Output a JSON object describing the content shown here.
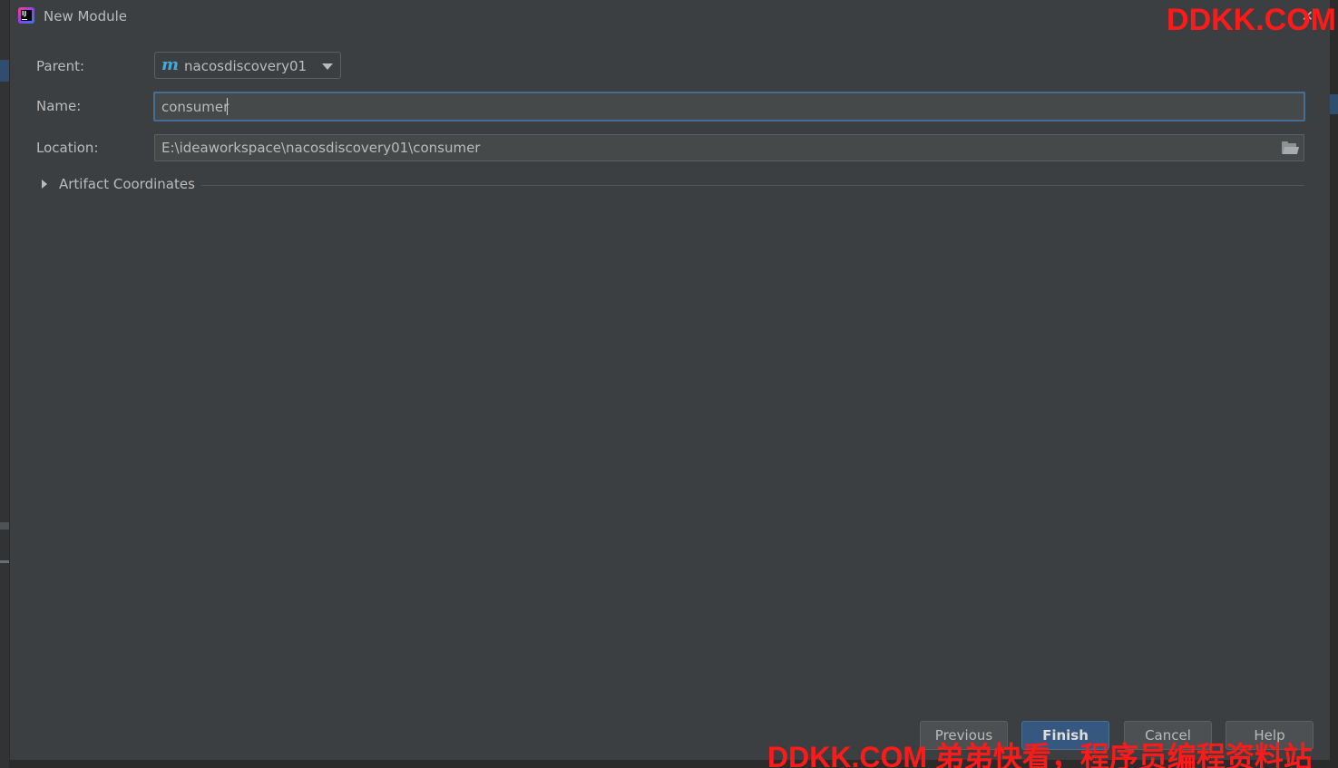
{
  "dialog": {
    "title": "New Module",
    "app_icon_text": "IJ"
  },
  "watermarks": {
    "top": "DDKK.COM",
    "bottom": "DDKK.COM 弟弟快看，程序员编程资料站"
  },
  "form": {
    "parent_label": "Parent:",
    "parent_value": "nacosdiscovery01",
    "parent_icon": "m",
    "name_label": "Name:",
    "name_value": "consumer",
    "location_label": "Location:",
    "location_value": "E:\\ideaworkspace\\nacosdiscovery01\\consumer"
  },
  "sections": {
    "artifact_label": "Artifact Coordinates"
  },
  "buttons": {
    "previous": "Previous",
    "finish": "Finish",
    "cancel": "Cancel",
    "help": "Help"
  },
  "colors": {
    "dialog_bg": "#3c3f41",
    "field_bg": "#45494a",
    "focus_border": "#466d94",
    "primary_button": "#365880",
    "watermark": "#ff1a1a",
    "maven_icon": "#4aa8d8"
  },
  "icons": {
    "app": "intellij-icon",
    "close": "close-icon",
    "module": "maven-module-icon",
    "dropdown": "chevron-down-icon",
    "folder": "folder-icon",
    "expand": "expand-triangle-icon"
  }
}
